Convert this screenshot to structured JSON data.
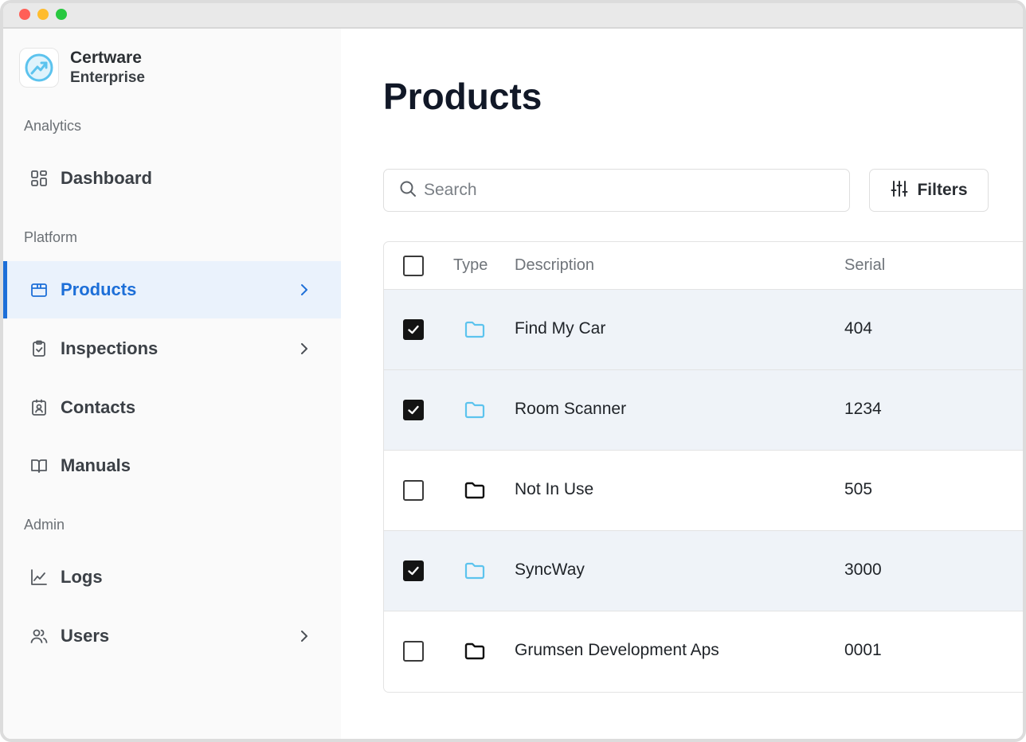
{
  "window": {
    "controls": [
      "close",
      "minimize",
      "zoom"
    ]
  },
  "brand": {
    "name": "Certware",
    "subtitle": "Enterprise",
    "logo_icon": "trend-arrow-circle-icon",
    "accent": "#5cc3ee"
  },
  "sidebar": {
    "sections": [
      {
        "label": "Analytics"
      },
      {
        "label": "Platform"
      },
      {
        "label": "Admin"
      }
    ],
    "items": [
      {
        "label": "Dashboard",
        "icon": "grid-icon",
        "active": false,
        "has_chevron": false
      },
      {
        "label": "Products",
        "icon": "package-icon",
        "active": true,
        "has_chevron": true
      },
      {
        "label": "Inspections",
        "icon": "clipboard-check-icon",
        "active": false,
        "has_chevron": true
      },
      {
        "label": "Contacts",
        "icon": "contact-card-icon",
        "active": false,
        "has_chevron": false
      },
      {
        "label": "Manuals",
        "icon": "book-open-icon",
        "active": false,
        "has_chevron": false
      },
      {
        "label": "Logs",
        "icon": "line-chart-icon",
        "active": false,
        "has_chevron": false
      },
      {
        "label": "Users",
        "icon": "users-icon",
        "active": false,
        "has_chevron": true
      }
    ],
    "active_color": "#1d6fd8"
  },
  "main": {
    "title": "Products",
    "search": {
      "placeholder": "Search",
      "value": ""
    },
    "filters_label": "Filters",
    "table": {
      "columns": [
        "Type",
        "Description",
        "Serial"
      ],
      "header_checked": false,
      "rows": [
        {
          "checked": true,
          "type": "folder-icon",
          "type_color": "#5cc3ee",
          "description": "Find My Car",
          "serial": "404"
        },
        {
          "checked": true,
          "type": "folder-icon",
          "type_color": "#5cc3ee",
          "description": "Room Scanner",
          "serial": "1234"
        },
        {
          "checked": false,
          "type": "folder-icon",
          "type_color": "#111111",
          "description": "Not In Use",
          "serial": "505"
        },
        {
          "checked": true,
          "type": "folder-icon",
          "type_color": "#5cc3ee",
          "description": "SyncWay",
          "serial": "3000"
        },
        {
          "checked": false,
          "type": "folder-icon",
          "type_color": "#111111",
          "description": "Grumsen Development Aps",
          "serial": "0001"
        }
      ]
    }
  }
}
